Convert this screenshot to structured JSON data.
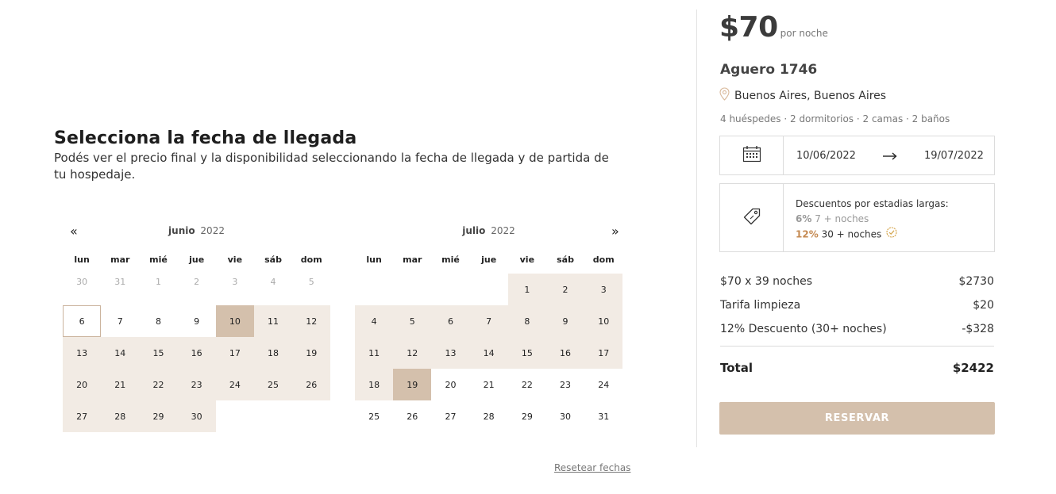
{
  "calendar": {
    "title": "Selecciona la fecha de llegada",
    "subtitle": "Podés ver el precio final y la disponibilidad seleccionando la fecha de llegada y de partida de tu hospedaje.",
    "prev_label": "«",
    "next_label": "»",
    "weekdays": [
      "lun",
      "mar",
      "mié",
      "jue",
      "vie",
      "sáb",
      "dom"
    ],
    "months": [
      {
        "name": "junio",
        "year": "2022",
        "days": [
          {
            "d": "30",
            "s": "muted"
          },
          {
            "d": "31",
            "s": "muted"
          },
          {
            "d": "1",
            "s": "muted"
          },
          {
            "d": "2",
            "s": "muted"
          },
          {
            "d": "3",
            "s": "muted"
          },
          {
            "d": "4",
            "s": "muted"
          },
          {
            "d": "5",
            "s": "muted"
          },
          {
            "d": "6",
            "s": "start"
          },
          {
            "d": "7",
            "s": ""
          },
          {
            "d": "8",
            "s": ""
          },
          {
            "d": "9",
            "s": ""
          },
          {
            "d": "10",
            "s": "sel"
          },
          {
            "d": "11",
            "s": "range"
          },
          {
            "d": "12",
            "s": "range"
          },
          {
            "d": "13",
            "s": "range"
          },
          {
            "d": "14",
            "s": "range"
          },
          {
            "d": "15",
            "s": "range"
          },
          {
            "d": "16",
            "s": "range"
          },
          {
            "d": "17",
            "s": "range"
          },
          {
            "d": "18",
            "s": "range"
          },
          {
            "d": "19",
            "s": "range"
          },
          {
            "d": "20",
            "s": "range"
          },
          {
            "d": "21",
            "s": "range"
          },
          {
            "d": "22",
            "s": "range"
          },
          {
            "d": "23",
            "s": "range"
          },
          {
            "d": "24",
            "s": "range"
          },
          {
            "d": "25",
            "s": "range"
          },
          {
            "d": "26",
            "s": "range"
          },
          {
            "d": "27",
            "s": "range"
          },
          {
            "d": "28",
            "s": "range"
          },
          {
            "d": "29",
            "s": "range"
          },
          {
            "d": "30",
            "s": "range"
          },
          {
            "d": "",
            "s": "empty"
          },
          {
            "d": "",
            "s": "empty"
          },
          {
            "d": "",
            "s": "empty"
          }
        ]
      },
      {
        "name": "julio",
        "year": "2022",
        "days": [
          {
            "d": "",
            "s": "empty"
          },
          {
            "d": "",
            "s": "empty"
          },
          {
            "d": "",
            "s": "empty"
          },
          {
            "d": "",
            "s": "empty"
          },
          {
            "d": "1",
            "s": "range"
          },
          {
            "d": "2",
            "s": "range"
          },
          {
            "d": "3",
            "s": "range"
          },
          {
            "d": "4",
            "s": "range"
          },
          {
            "d": "5",
            "s": "range"
          },
          {
            "d": "6",
            "s": "range"
          },
          {
            "d": "7",
            "s": "range"
          },
          {
            "d": "8",
            "s": "range"
          },
          {
            "d": "9",
            "s": "range"
          },
          {
            "d": "10",
            "s": "range"
          },
          {
            "d": "11",
            "s": "range"
          },
          {
            "d": "12",
            "s": "range"
          },
          {
            "d": "13",
            "s": "range"
          },
          {
            "d": "14",
            "s": "range"
          },
          {
            "d": "15",
            "s": "range"
          },
          {
            "d": "16",
            "s": "range"
          },
          {
            "d": "17",
            "s": "range"
          },
          {
            "d": "18",
            "s": "range"
          },
          {
            "d": "19",
            "s": "sel"
          },
          {
            "d": "20",
            "s": ""
          },
          {
            "d": "21",
            "s": ""
          },
          {
            "d": "22",
            "s": ""
          },
          {
            "d": "23",
            "s": ""
          },
          {
            "d": "24",
            "s": ""
          },
          {
            "d": "25",
            "s": ""
          },
          {
            "d": "26",
            "s": ""
          },
          {
            "d": "27",
            "s": ""
          },
          {
            "d": "28",
            "s": ""
          },
          {
            "d": "29",
            "s": ""
          },
          {
            "d": "30",
            "s": ""
          },
          {
            "d": "31",
            "s": ""
          }
        ]
      }
    ],
    "reset_label": "Resetear fechas"
  },
  "booking": {
    "price": "$70",
    "price_unit": "por noche",
    "property_name": "Aguero 1746",
    "location": "Buenos Aires, Buenos Aires",
    "details": "4 huéspedes · 2 dormitorios · 2 camas · 2 baños",
    "checkin": "10/06/2022",
    "checkout": "19/07/2022",
    "discount_title": "Descuentos por estadias largas:",
    "discount_1_pct": "6%",
    "discount_1_label": "7 + noches",
    "discount_2_pct": "12%",
    "discount_2_label": "30 + noches",
    "line_items": [
      {
        "label": "$70 x 39 noches",
        "value": "$2730"
      },
      {
        "label": "Tarifa limpieza",
        "value": "$20"
      },
      {
        "label": "12% Descuento (30+ noches)",
        "value": "-$328"
      }
    ],
    "total_label": "Total",
    "total_value": "$2422",
    "reserve_label": "RESERVAR"
  },
  "icons": {
    "calendar": "calendar-icon",
    "tag": "tag-icon",
    "pin": "map-pin-icon",
    "check": "check-circle-icon",
    "arrow": "arrow-right-icon"
  },
  "colors": {
    "accent": "#d4c0ac",
    "range": "#f2ebe4",
    "discount_active": "#c58a52"
  }
}
